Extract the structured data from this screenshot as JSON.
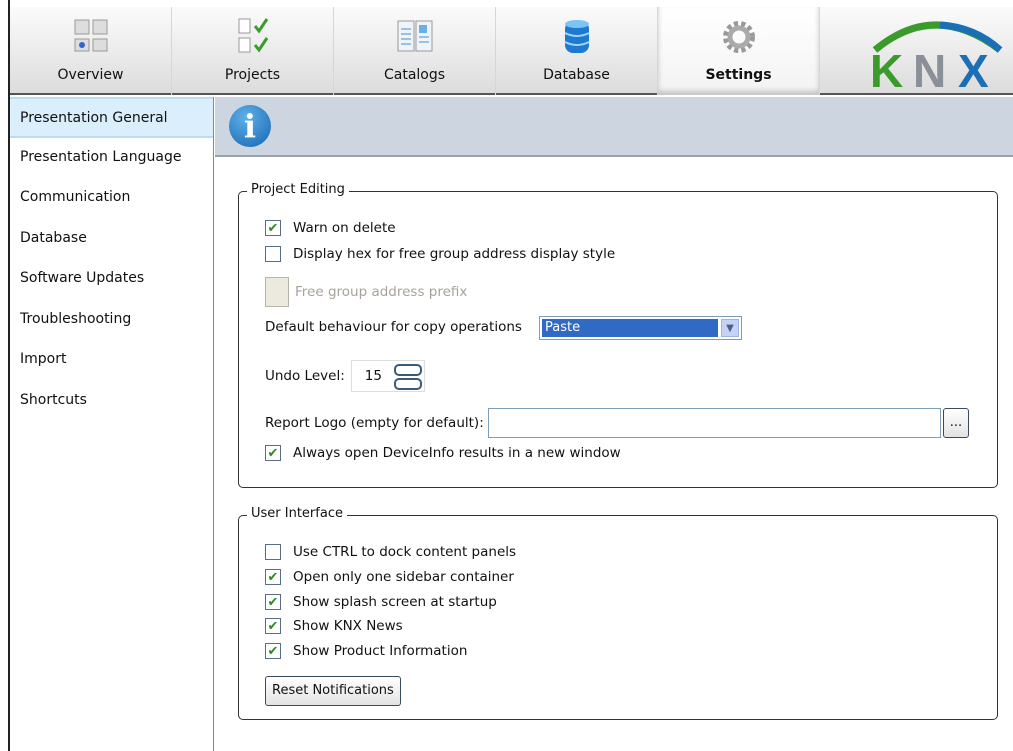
{
  "toolbar": {
    "tabs": [
      {
        "label": "Overview"
      },
      {
        "label": "Projects"
      },
      {
        "label": "Catalogs"
      },
      {
        "label": "Database"
      },
      {
        "label": "Settings"
      }
    ],
    "selected": "Settings",
    "logo": "KNX"
  },
  "sidebar": {
    "items": [
      "Presentation General",
      "Presentation Language",
      "Communication",
      "Database",
      "Software Updates",
      "Troubleshooting",
      "Import",
      "Shortcuts"
    ],
    "selected": "Presentation General"
  },
  "header": {
    "icon": "info-icon"
  },
  "project_editing": {
    "title": "Project Editing",
    "warn_on_delete": {
      "label": "Warn on delete",
      "checked": true
    },
    "display_hex": {
      "label": "Display hex for free group address display style",
      "checked": false
    },
    "free_prefix_label": "Free group address prefix",
    "copy_label": "Default behaviour for copy operations",
    "copy_value": "Paste",
    "undo_label": "Undo Level:",
    "undo_value": "15",
    "report_logo_label": "Report Logo (empty for default):",
    "report_logo_value": "",
    "browse_label": "...",
    "device_info": {
      "label": "Always open DeviceInfo results in a new window",
      "checked": true
    }
  },
  "user_interface": {
    "title": "User Interface",
    "options": [
      {
        "label": "Use CTRL to dock content panels",
        "checked": false
      },
      {
        "label": "Open only one sidebar container",
        "checked": true
      },
      {
        "label": "Show splash screen at startup",
        "checked": true
      },
      {
        "label": "Show KNX News",
        "checked": true
      },
      {
        "label": "Show Product Information",
        "checked": true
      }
    ],
    "reset_label": "Reset Notifications"
  },
  "colors": {
    "accent": "#316ac5",
    "header_bg": "#cdd6e0",
    "knx_green": "#3a9b2a",
    "knx_blue": "#1b6fb5"
  }
}
